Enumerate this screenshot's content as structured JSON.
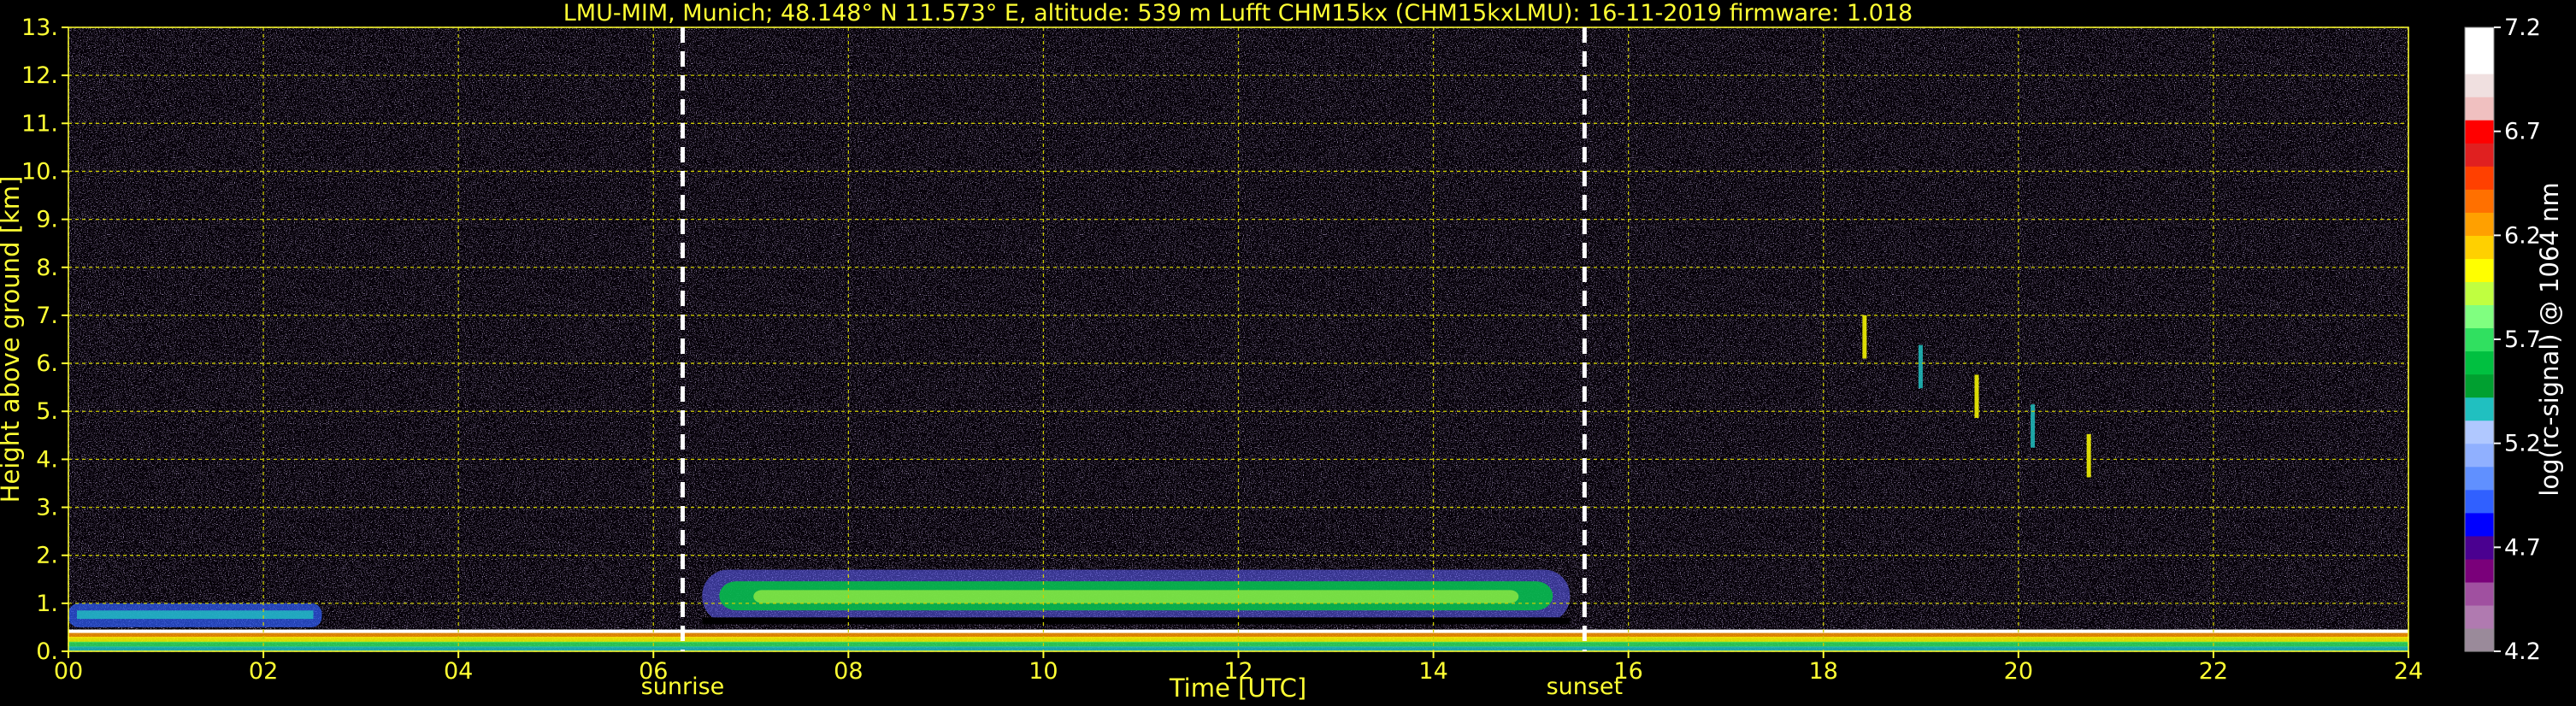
{
  "chart_data": {
    "type": "heatmap",
    "title": "LMU-MIM, Munich; 48.148° N 11.573° E, altitude: 539 m    Lufft CHM15kx (CHM15kxLMU): 16-11-2019    firmware: 1.018",
    "xlabel": "Time [UTC]",
    "ylabel": "Height above ground [km]",
    "xlim": [
      0,
      24
    ],
    "ylim": [
      0,
      13
    ],
    "x_ticks": [
      "00",
      "02",
      "04",
      "06",
      "08",
      "10",
      "12",
      "14",
      "16",
      "18",
      "20",
      "22",
      "24"
    ],
    "y_ticks": [
      "0.",
      "1.",
      "2.",
      "3.",
      "4.",
      "5.",
      "6.",
      "7.",
      "8.",
      "9.",
      "10.",
      "11.",
      "12.",
      "13."
    ],
    "grid": true,
    "annotations": [
      {
        "label": "sunrise",
        "x": 6.3
      },
      {
        "label": "sunset",
        "x": 15.55
      }
    ],
    "colorbar": {
      "label": "log(rc-signal) @ 1064 nm",
      "range": [
        4.2,
        7.2
      ],
      "ticks": [
        "4.2",
        "4.7",
        "5.2",
        "5.7",
        "6.2",
        "6.7",
        "7.2"
      ],
      "colors": [
        "#9a8a9a",
        "#b07ab0",
        "#a050a0",
        "#7a007a",
        "#4a0090",
        "#0000ff",
        "#3060ff",
        "#6090ff",
        "#90b0ff",
        "#b0c8ff",
        "#20c0c0",
        "#00a030",
        "#00c040",
        "#30e060",
        "#80ff80",
        "#c0ff40",
        "#ffff00",
        "#ffd000",
        "#ffa000",
        "#ff7000",
        "#ff4000",
        "#e02020",
        "#ff0000",
        "#f0c0c0",
        "#f0e0e0",
        "#ffffff",
        "#ffffff"
      ]
    },
    "features": [
      {
        "name": "boundary layer aerosol",
        "x_range": [
          0,
          24
        ],
        "height_km": [
          0,
          0.4
        ]
      },
      {
        "name": "night residual layer",
        "x_range": [
          0,
          2.6
        ],
        "height_km": [
          0.5,
          1.0
        ]
      },
      {
        "name": "daytime cloud layer",
        "x_range": [
          6.5,
          15.4
        ],
        "height_km": [
          0.6,
          1.7
        ]
      },
      {
        "name": "high cloud streaks",
        "x_range": [
          18.4,
          20.7
        ],
        "height_km": [
          3.7,
          7.0
        ]
      }
    ]
  }
}
